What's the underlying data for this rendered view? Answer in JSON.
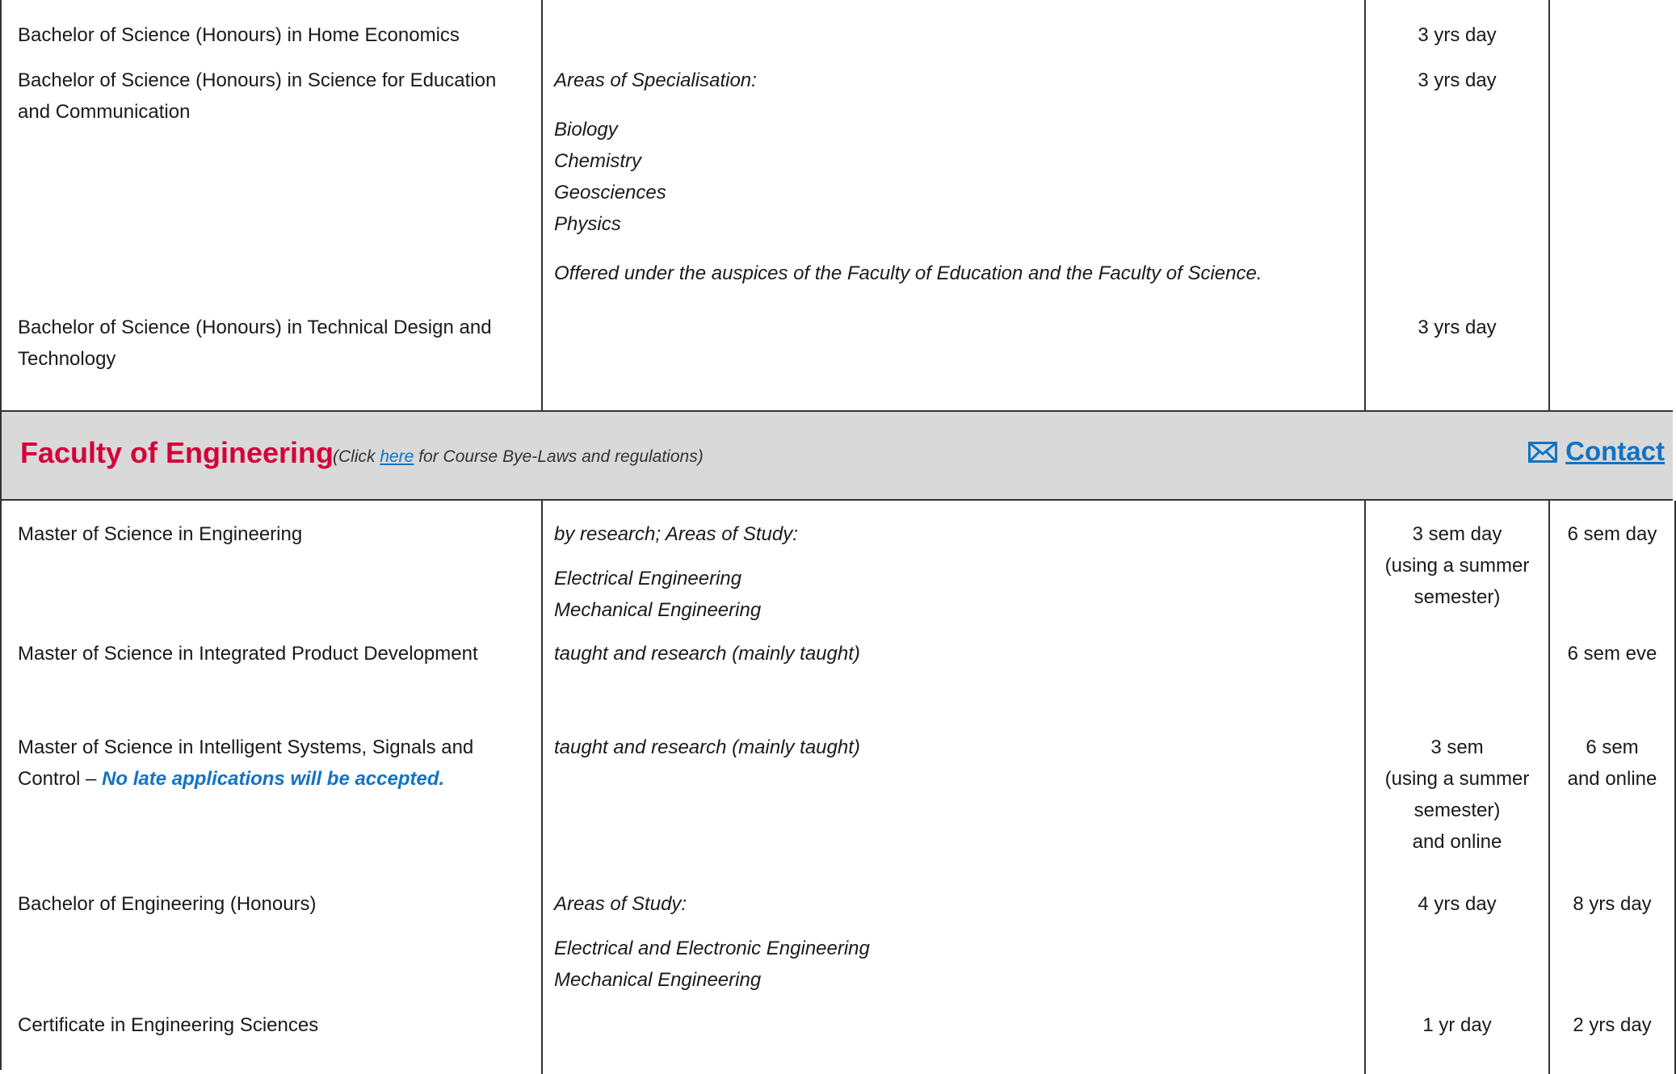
{
  "top_rows": [
    {
      "program": "Bachelor of Science (Honours) in Home Economics",
      "duration_ft": "3 yrs day"
    },
    {
      "program": "Bachelor of Science (Honours) in Science for Education and Communication",
      "areas_label": "Areas of Specialisation:",
      "areas": [
        "Biology",
        "Chemistry",
        "Geosciences",
        "Physics"
      ],
      "note": "Offered under the auspices of the Faculty of Education and the Faculty of Science.",
      "duration_ft": "3 yrs day"
    },
    {
      "program": "Bachelor of Science (Honours) in Technical Design and Technology",
      "duration_ft": "3 yrs day"
    }
  ],
  "faculty": {
    "title": "Faculty of Engineering",
    "note_prefix": "(Click ",
    "note_link": "here",
    "note_suffix": " for Course Bye-Laws and regulations)",
    "contact_label": "Contact",
    "contact_icon": "envelope-icon",
    "accent_color": "#d4003a",
    "link_color": "#1273c5"
  },
  "engineering_rows": [
    {
      "program": "Master of Science in Engineering",
      "details_label": "by research; Areas of Study:",
      "areas": [
        "Electrical Engineering",
        "Mechanical Engineering"
      ],
      "duration_ft": [
        "3 sem day",
        "(using a summer",
        "semester)"
      ],
      "duration_pt": [
        "6 sem day"
      ]
    },
    {
      "program": "Master of Science in Integrated Product Development",
      "details_label": "taught and research (mainly taught)",
      "duration_ft": [],
      "duration_pt": [
        "6 sem eve"
      ]
    },
    {
      "program": "Master of Science in Intelligent Systems, Signals and Control – ",
      "program_note": "No late applications will be accepted.",
      "details_label": "taught and research (mainly taught)",
      "duration_ft": [
        "3 sem",
        "(using a summer",
        "semester)",
        "and online"
      ],
      "duration_pt": [
        "6 sem",
        "and online"
      ]
    },
    {
      "program": "Bachelor of Engineering (Honours)",
      "details_label": "Areas of Study:",
      "areas": [
        "Electrical and Electronic Engineering",
        "Mechanical Engineering"
      ],
      "duration_ft": [
        "4 yrs day"
      ],
      "duration_pt": [
        "8 yrs day"
      ]
    },
    {
      "program": "Certificate in Engineering Sciences",
      "duration_ft": [
        "1 yr day"
      ],
      "duration_pt": [
        "2 yrs day"
      ]
    }
  ]
}
